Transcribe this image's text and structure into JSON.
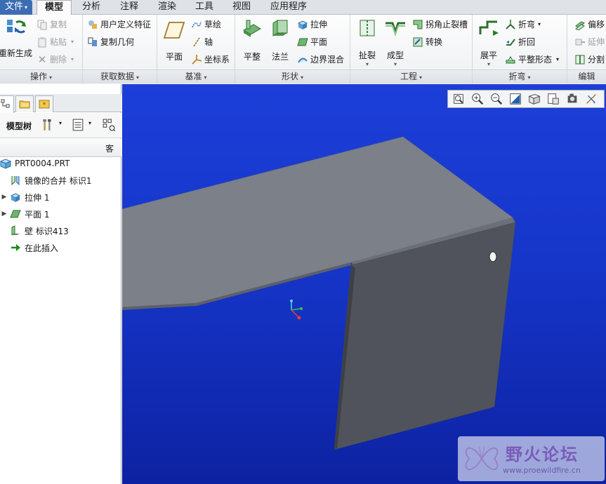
{
  "menu": {
    "file": "文件",
    "tabs": [
      "模型",
      "分析",
      "注释",
      "渲染",
      "工具",
      "视图",
      "应用程序"
    ]
  },
  "ribbon": {
    "operations": {
      "label": "操作",
      "regenerate": "重新生成",
      "copy": "复制",
      "paste": "粘贴",
      "delete": "删除"
    },
    "get_data": {
      "label": "获取数据",
      "udf": "用户定义特征",
      "copy_geom": "复制几何"
    },
    "datum": {
      "label": "基准",
      "plane": "平面",
      "sketch": "草绘",
      "axis": "轴",
      "csys": "坐标系"
    },
    "shapes": {
      "label": "形状",
      "flat": "平整",
      "flange": "法兰",
      "extrude": "拉伸",
      "plane": "平面",
      "boundary_blend": "边界混合"
    },
    "engineering": {
      "label": "工程",
      "rip": "扯裂",
      "form": "成型",
      "corner_relief": "拐角止裂槽",
      "convert": "转换"
    },
    "bends": {
      "label": "折弯",
      "unbend": "展平",
      "bend": "折弯",
      "bend_back": "折回",
      "flatten_form": "平整形态"
    },
    "editing": {
      "label": "编辑",
      "offset": "偏移",
      "extend": "延伸",
      "split": "分割"
    }
  },
  "panel": {
    "tree_label": "模型树",
    "column_header": "客",
    "tree": [
      {
        "label": "PRT0004.PRT",
        "icon": "part-icon",
        "expander": ""
      },
      {
        "label": "镜像的合并 标识1",
        "icon": "mirror-merge-icon",
        "expander": ""
      },
      {
        "label": "拉伸 1",
        "icon": "extrude-icon",
        "expander": "▶"
      },
      {
        "label": "平面 1",
        "icon": "plane-icon",
        "expander": "▶"
      },
      {
        "label": "壁 标识413",
        "icon": "wall-icon",
        "expander": ""
      },
      {
        "label": "在此插入",
        "icon": "insert-here-icon",
        "expander": ""
      }
    ]
  },
  "watermark": {
    "title": "野火论坛",
    "url": "www.proewildfire.cn"
  },
  "colors": {
    "viewport_top": "#1c3fd9",
    "viewport_bottom": "#0d22a2",
    "file_tab": "#3c6db3",
    "model_top_face": "#7b8089",
    "model_front_face": "#50535b"
  }
}
